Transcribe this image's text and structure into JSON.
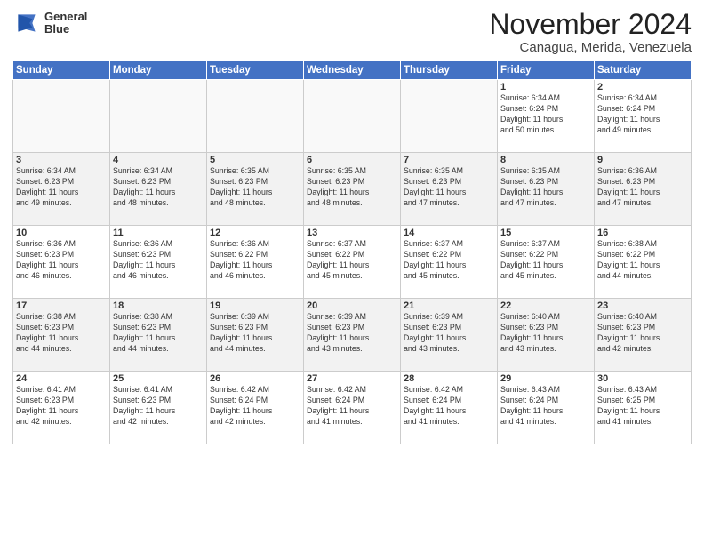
{
  "header": {
    "logo_line1": "General",
    "logo_line2": "Blue",
    "title": "November 2024",
    "subtitle": "Canagua, Merida, Venezuela"
  },
  "days_of_week": [
    "Sunday",
    "Monday",
    "Tuesday",
    "Wednesday",
    "Thursday",
    "Friday",
    "Saturday"
  ],
  "weeks": [
    [
      {
        "day": "",
        "info": ""
      },
      {
        "day": "",
        "info": ""
      },
      {
        "day": "",
        "info": ""
      },
      {
        "day": "",
        "info": ""
      },
      {
        "day": "",
        "info": ""
      },
      {
        "day": "1",
        "info": "Sunrise: 6:34 AM\nSunset: 6:24 PM\nDaylight: 11 hours\nand 50 minutes."
      },
      {
        "day": "2",
        "info": "Sunrise: 6:34 AM\nSunset: 6:24 PM\nDaylight: 11 hours\nand 49 minutes."
      }
    ],
    [
      {
        "day": "3",
        "info": "Sunrise: 6:34 AM\nSunset: 6:23 PM\nDaylight: 11 hours\nand 49 minutes."
      },
      {
        "day": "4",
        "info": "Sunrise: 6:34 AM\nSunset: 6:23 PM\nDaylight: 11 hours\nand 48 minutes."
      },
      {
        "day": "5",
        "info": "Sunrise: 6:35 AM\nSunset: 6:23 PM\nDaylight: 11 hours\nand 48 minutes."
      },
      {
        "day": "6",
        "info": "Sunrise: 6:35 AM\nSunset: 6:23 PM\nDaylight: 11 hours\nand 48 minutes."
      },
      {
        "day": "7",
        "info": "Sunrise: 6:35 AM\nSunset: 6:23 PM\nDaylight: 11 hours\nand 47 minutes."
      },
      {
        "day": "8",
        "info": "Sunrise: 6:35 AM\nSunset: 6:23 PM\nDaylight: 11 hours\nand 47 minutes."
      },
      {
        "day": "9",
        "info": "Sunrise: 6:36 AM\nSunset: 6:23 PM\nDaylight: 11 hours\nand 47 minutes."
      }
    ],
    [
      {
        "day": "10",
        "info": "Sunrise: 6:36 AM\nSunset: 6:23 PM\nDaylight: 11 hours\nand 46 minutes."
      },
      {
        "day": "11",
        "info": "Sunrise: 6:36 AM\nSunset: 6:23 PM\nDaylight: 11 hours\nand 46 minutes."
      },
      {
        "day": "12",
        "info": "Sunrise: 6:36 AM\nSunset: 6:22 PM\nDaylight: 11 hours\nand 46 minutes."
      },
      {
        "day": "13",
        "info": "Sunrise: 6:37 AM\nSunset: 6:22 PM\nDaylight: 11 hours\nand 45 minutes."
      },
      {
        "day": "14",
        "info": "Sunrise: 6:37 AM\nSunset: 6:22 PM\nDaylight: 11 hours\nand 45 minutes."
      },
      {
        "day": "15",
        "info": "Sunrise: 6:37 AM\nSunset: 6:22 PM\nDaylight: 11 hours\nand 45 minutes."
      },
      {
        "day": "16",
        "info": "Sunrise: 6:38 AM\nSunset: 6:22 PM\nDaylight: 11 hours\nand 44 minutes."
      }
    ],
    [
      {
        "day": "17",
        "info": "Sunrise: 6:38 AM\nSunset: 6:23 PM\nDaylight: 11 hours\nand 44 minutes."
      },
      {
        "day": "18",
        "info": "Sunrise: 6:38 AM\nSunset: 6:23 PM\nDaylight: 11 hours\nand 44 minutes."
      },
      {
        "day": "19",
        "info": "Sunrise: 6:39 AM\nSunset: 6:23 PM\nDaylight: 11 hours\nand 44 minutes."
      },
      {
        "day": "20",
        "info": "Sunrise: 6:39 AM\nSunset: 6:23 PM\nDaylight: 11 hours\nand 43 minutes."
      },
      {
        "day": "21",
        "info": "Sunrise: 6:39 AM\nSunset: 6:23 PM\nDaylight: 11 hours\nand 43 minutes."
      },
      {
        "day": "22",
        "info": "Sunrise: 6:40 AM\nSunset: 6:23 PM\nDaylight: 11 hours\nand 43 minutes."
      },
      {
        "day": "23",
        "info": "Sunrise: 6:40 AM\nSunset: 6:23 PM\nDaylight: 11 hours\nand 42 minutes."
      }
    ],
    [
      {
        "day": "24",
        "info": "Sunrise: 6:41 AM\nSunset: 6:23 PM\nDaylight: 11 hours\nand 42 minutes."
      },
      {
        "day": "25",
        "info": "Sunrise: 6:41 AM\nSunset: 6:23 PM\nDaylight: 11 hours\nand 42 minutes."
      },
      {
        "day": "26",
        "info": "Sunrise: 6:42 AM\nSunset: 6:24 PM\nDaylight: 11 hours\nand 42 minutes."
      },
      {
        "day": "27",
        "info": "Sunrise: 6:42 AM\nSunset: 6:24 PM\nDaylight: 11 hours\nand 41 minutes."
      },
      {
        "day": "28",
        "info": "Sunrise: 6:42 AM\nSunset: 6:24 PM\nDaylight: 11 hours\nand 41 minutes."
      },
      {
        "day": "29",
        "info": "Sunrise: 6:43 AM\nSunset: 6:24 PM\nDaylight: 11 hours\nand 41 minutes."
      },
      {
        "day": "30",
        "info": "Sunrise: 6:43 AM\nSunset: 6:25 PM\nDaylight: 11 hours\nand 41 minutes."
      }
    ]
  ]
}
